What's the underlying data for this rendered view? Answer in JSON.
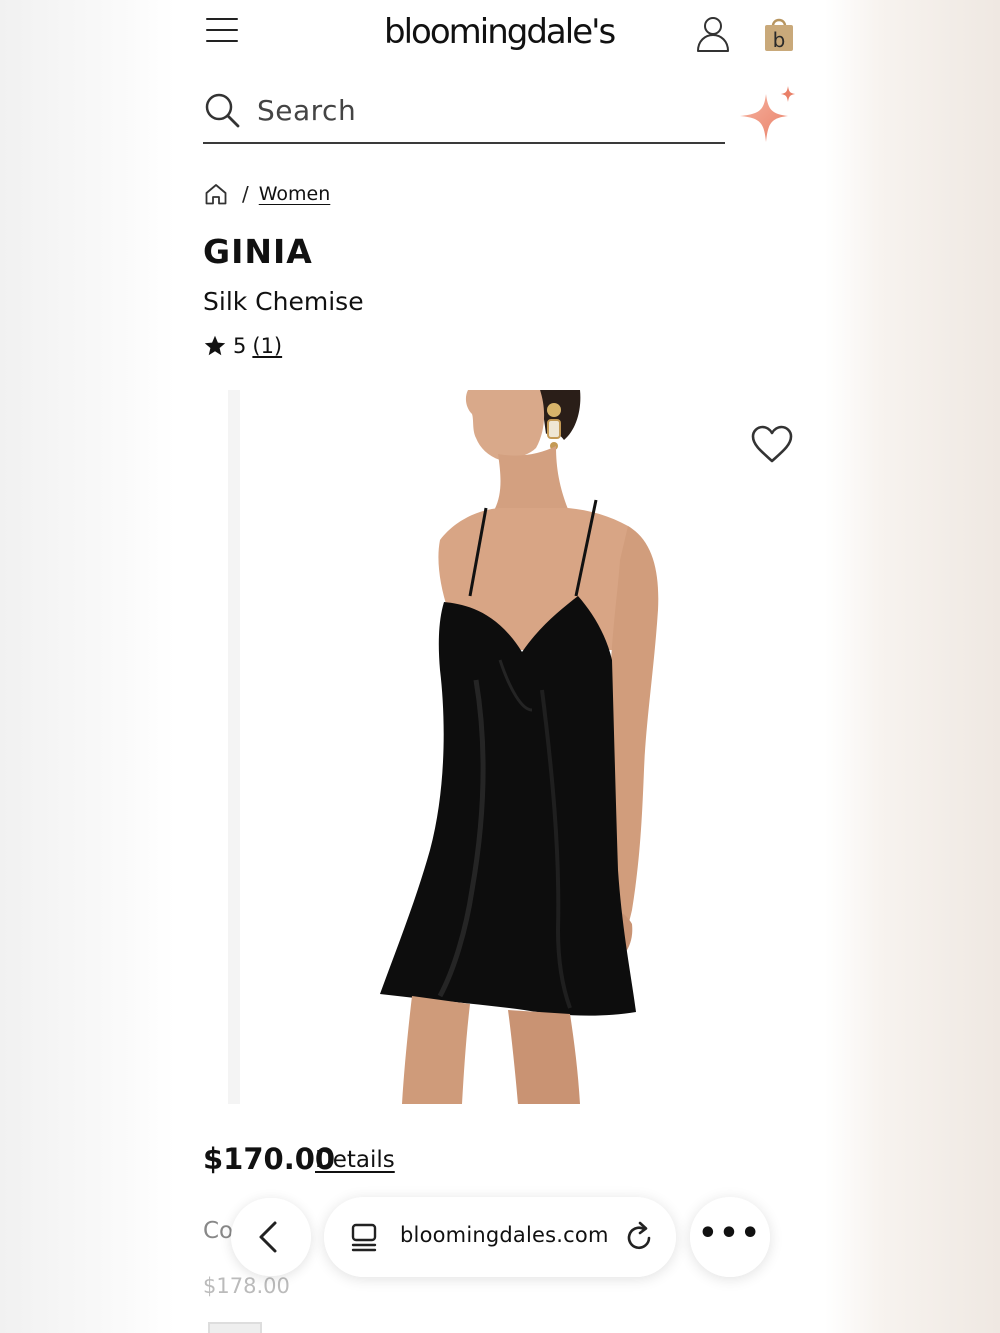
{
  "header": {
    "logo_text": "bloomingdale's",
    "bag_letter": "b",
    "icons": [
      "menu-icon",
      "account-icon",
      "shopping-bag-icon"
    ]
  },
  "search": {
    "placeholder": "Search",
    "icon": "search-icon",
    "ai_icon": "sparkle-icon",
    "accent_color": "#f09a86"
  },
  "breadcrumb": {
    "home_icon": "home-icon",
    "separator": "/",
    "items": [
      {
        "label": "Women"
      }
    ]
  },
  "product": {
    "brand": "GINIA",
    "name": "Silk Chemise",
    "rating": {
      "value": "5",
      "count": "(1)",
      "icon": "star-icon"
    },
    "price": "$170.00",
    "details_label": "Details",
    "color_label": "Co",
    "previous_price": "$178.00",
    "wishlist_icon": "heart-icon",
    "dress_color": "#0d0d0d"
  },
  "browser": {
    "url": "bloomingdales.com",
    "more_label": "•••",
    "icons": [
      "back-icon",
      "tabs-icon",
      "reload-icon",
      "more-icon"
    ]
  }
}
